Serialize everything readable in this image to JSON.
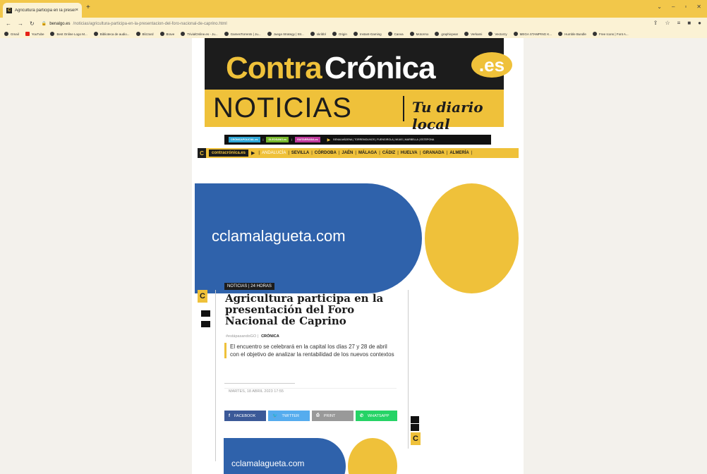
{
  "browser": {
    "tab_title": "Agricultura participa en la presen",
    "tab_close": "×",
    "new_tab": "+",
    "url_host": "benalgo.es",
    "url_path": "/noticias/agricultura-participa-en-la-presentacion-del-foro-nacional-de-caprino.html",
    "bookmarks": [
      "Gmail",
      "YouTube",
      "Best Online Logo M...",
      "Biblioteca de audio...",
      "Blizzard",
      "Brave",
      "TrivialOnline.es - Ju...",
      "GamesTorrents | Ju...",
      "Juega Strategy | Str...",
      "skribbl",
      "Origin",
      "Instant-Gaming",
      "Canva",
      "Motorrso",
      "graphicpear",
      "Verkami",
      "Vectorzy",
      "MEGA STAMPING K...",
      "Humble Bundle",
      "Free Icons | Font A..."
    ]
  },
  "masthead": {
    "contra": "Contra",
    "cronica": "Crónica",
    "es": ".es",
    "noticias": "NOTICIAS",
    "tagline": "Tu diario local"
  },
  "sister_bar": {
    "chip1": "CRÓNICAPOLICIAL.es",
    "chip2": "OLEOSANO.es",
    "chip3": "GUITARRASIA.es",
    "towns": "BENALMÁDENA | TORREMOLINOS | FUENGIROLA | MIJAS | MARBELLA | ESTEPONA"
  },
  "regions": {
    "brand": "contracrónica.es",
    "items": [
      "ANDALUCÍA",
      "SEVILLA",
      "CÓRDOBA",
      "JAÉN",
      "MÁLAGA",
      "CÁDIZ",
      "HUELVA",
      "GRANADA",
      "ALMERÍA"
    ]
  },
  "ad": {
    "text": "cclamalagueta.com"
  },
  "article": {
    "label": "NOTICIAS | 24 HORAS",
    "headline": "Agricultura participa en la presentación del Foro Nacional de Caprino",
    "tag1": "#estápasandoGO |",
    "tag2": "CRÓNICA",
    "summary": "El encuentro se celebrará en la capital los días 27 y 28 de abril con el objetivo de analizar la rentabilidad de los nuevos contextos",
    "date": "MARTES, 18 ABRIL 2023 17:55"
  },
  "share": {
    "facebook": "FACEBOOK",
    "twitter": "TWITTER",
    "print": "PRINT",
    "whatsapp": "WHATSAPP"
  },
  "side_logo": "C"
}
